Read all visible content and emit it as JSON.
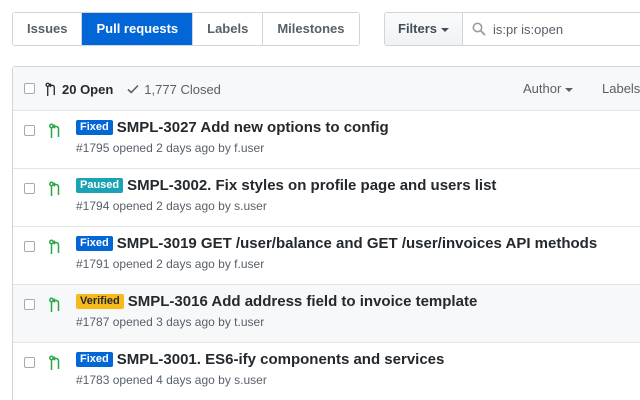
{
  "subnav": {
    "tabs": [
      {
        "label": "Issues",
        "selected": false
      },
      {
        "label": "Pull requests",
        "selected": true
      },
      {
        "label": "Labels",
        "selected": false
      },
      {
        "label": "Milestones",
        "selected": false
      }
    ]
  },
  "filters": {
    "button_label": "Filters",
    "search_value": "is:pr is:open"
  },
  "list_header": {
    "open_label": "20 Open",
    "closed_label": "1,777 Closed",
    "author_label": "Author",
    "labels_label": "Labels"
  },
  "colors": {
    "accent": "#0366d6",
    "open_green": "#28a745",
    "label_fixed": "#0366d6",
    "label_paused": "#1aa3b5",
    "label_verified": "#f6bb1b"
  },
  "issues": [
    {
      "label": "Fixed",
      "label_color": "#0366d6",
      "label_text_color": "#ffffff",
      "title": "SMPL-3027 Add new options to config",
      "number": "#1795",
      "opened": "opened 2 days ago by",
      "author": "f.user"
    },
    {
      "label": "Paused",
      "label_color": "#1aa3b5",
      "label_text_color": "#ffffff",
      "title": "SMPL-3002. Fix styles on profile page and users list",
      "number": "#1794",
      "opened": "opened 2 days ago by",
      "author": "s.user"
    },
    {
      "label": "Fixed",
      "label_color": "#0366d6",
      "label_text_color": "#ffffff",
      "title": "SMPL-3019 GET /user/balance and GET /user/invoices API methods",
      "number": "#1791",
      "opened": "opened 2 days ago by",
      "author": "f.user"
    },
    {
      "label": "Verified",
      "label_color": "#f6bb1b",
      "label_text_color": "#24292e",
      "title": "SMPL-3016 Add address field to invoice template",
      "number": "#1787",
      "opened": "opened 3 days ago by",
      "author": "t.user"
    },
    {
      "label": "Fixed",
      "label_color": "#0366d6",
      "label_text_color": "#ffffff",
      "title": "SMPL-3001. ES6-ify components and services",
      "number": "#1783",
      "opened": "opened 4 days ago by",
      "author": "s.user"
    }
  ]
}
